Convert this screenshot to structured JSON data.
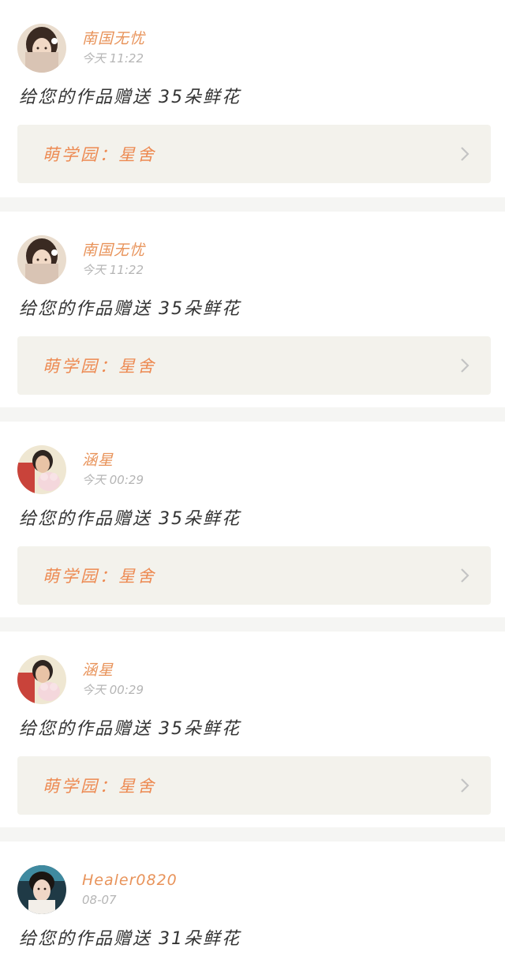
{
  "feed": {
    "items": [
      {
        "user": "南国无忧",
        "time": "今天 11:22",
        "message": "给您的作品赠送 35朵鲜花",
        "work_label": "萌学园：星舍",
        "avatar": "avatar-girl-traditional"
      },
      {
        "user": "南国无忧",
        "time": "今天 11:22",
        "message": "给您的作品赠送 35朵鲜花",
        "work_label": "萌学园：星舍",
        "avatar": "avatar-girl-traditional"
      },
      {
        "user": "涵星",
        "time": "今天 00:29",
        "message": "给您的作品赠送 35朵鲜花",
        "work_label": "萌学园：星舍",
        "avatar": "avatar-girl-with-plush"
      },
      {
        "user": "涵星",
        "time": "今天 00:29",
        "message": "给您的作品赠送 35朵鲜花",
        "work_label": "萌学园：星舍",
        "avatar": "avatar-girl-with-plush"
      },
      {
        "user": "Healer0820",
        "time": "08-07",
        "message": "给您的作品赠送 31朵鲜花",
        "avatar": "avatar-girl-portrait"
      }
    ]
  },
  "colors": {
    "accent": "#e8935a",
    "link_bg": "#f3f2ec",
    "separator": "#f5f5f3"
  }
}
